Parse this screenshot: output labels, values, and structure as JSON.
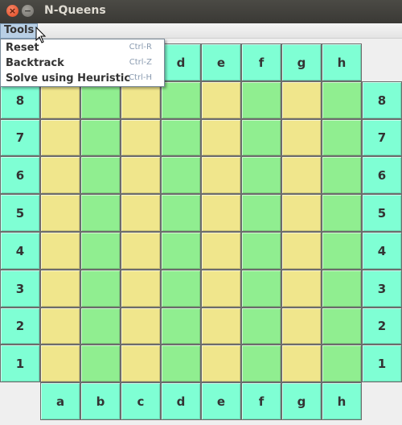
{
  "window": {
    "title": "N-Queens",
    "close_glyph": "×",
    "min_glyph": "−"
  },
  "menubar": {
    "tools_label": "Tools"
  },
  "tools_menu": {
    "items": [
      {
        "label": "Reset",
        "accelerator": "Ctrl-R"
      },
      {
        "label": "Backtrack",
        "accelerator": "Ctrl-Z"
      },
      {
        "label": "Solve using Heuristic",
        "accelerator": "Ctrl-H"
      }
    ]
  },
  "board": {
    "columns": [
      "a",
      "b",
      "c",
      "d",
      "e",
      "f",
      "g",
      "h"
    ],
    "rows": [
      "8",
      "7",
      "6",
      "5",
      "4",
      "3",
      "2",
      "1"
    ],
    "label_color": "#7fffd4",
    "square_colors": {
      "yellow": "#f0e68c",
      "green": "#90ee90"
    }
  }
}
